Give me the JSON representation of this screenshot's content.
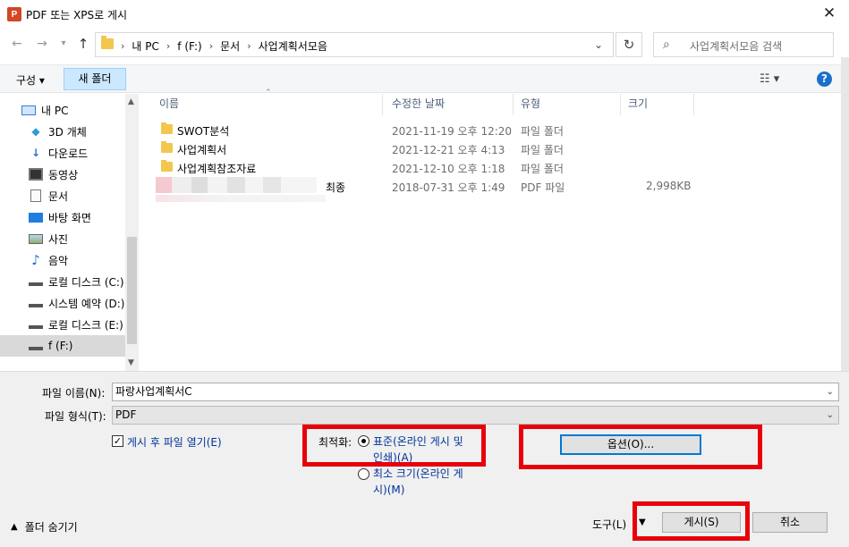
{
  "window": {
    "title": "PDF 또는 XPS로 게시",
    "app_icon": "P"
  },
  "nav": {
    "back": "←",
    "forward": "→",
    "recent": "▾",
    "up": "↑"
  },
  "address": {
    "crumbs": [
      "내 PC",
      "f (F:)",
      "문서",
      "사업계획서모음"
    ],
    "sep": "›"
  },
  "search": {
    "placeholder": "사업계획서모음 검색"
  },
  "toolbar": {
    "organize": "구성 ▾",
    "new_folder": "새 폴더",
    "view": "☷ ▾",
    "help": "?"
  },
  "sidebar": {
    "items": [
      {
        "label": "내 PC",
        "icon": "pc-icon"
      },
      {
        "label": "3D 개체",
        "icon": "cube-icon"
      },
      {
        "label": "다운로드",
        "icon": "download-icon"
      },
      {
        "label": "동영상",
        "icon": "video-icon"
      },
      {
        "label": "문서",
        "icon": "document-icon"
      },
      {
        "label": "바탕 화면",
        "icon": "desktop-icon"
      },
      {
        "label": "사진",
        "icon": "picture-icon"
      },
      {
        "label": "음악",
        "icon": "music-icon"
      },
      {
        "label": "로컬 디스크 (C:)",
        "icon": "drive-icon"
      },
      {
        "label": "시스템 예약 (D:)",
        "icon": "drive-icon"
      },
      {
        "label": "로컬 디스크 (E:)",
        "icon": "drive-icon"
      },
      {
        "label": "f (F:)",
        "icon": "drive-icon"
      }
    ]
  },
  "columns": {
    "name": "이름",
    "date": "수정한 날짜",
    "type": "유형",
    "size": "크기"
  },
  "files": [
    {
      "name": "SWOT분석",
      "date": "2021-11-19 오후 12:20",
      "type": "파일 폴더",
      "size": ""
    },
    {
      "name": "사업계획서",
      "date": "2021-12-21 오후 4:13",
      "type": "파일 폴더",
      "size": ""
    },
    {
      "name": "사업계획참조자료",
      "date": "2021-12-10 오후 1:18",
      "type": "파일 폴더",
      "size": ""
    },
    {
      "name": "최종",
      "date": "2018-07-31 오후 1:49",
      "type": "PDF 파일",
      "size": "2,998KB"
    }
  ],
  "form": {
    "filename_label": "파일 이름(N):",
    "filename_value": "파랑사업계획서C",
    "filetype_label": "파일 형식(T):",
    "filetype_value": "PDF",
    "open_after_label": "게시 후 파일 열기(E)",
    "optimize_label": "최적화:",
    "opt_standard_line1": "표준(온라인 게시 및",
    "opt_standard_line2": "인쇄)(A)",
    "opt_min_line1": "최소 크기(온라인 게",
    "opt_min_line2": "시)(M)",
    "options_button": "옵션(O)..."
  },
  "footer": {
    "hide_folders": "폴더 숨기기",
    "tools": "도구(L)",
    "publish": "게시(S)",
    "cancel": "취소"
  },
  "colors": {
    "highlight_box": "#e8000b",
    "accent": "#0078d7"
  }
}
